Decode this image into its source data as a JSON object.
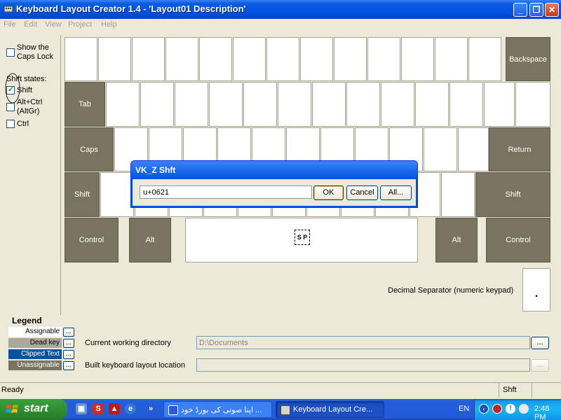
{
  "window": {
    "title": "Keyboard Layout Creator 1.4 - 'Layout01 Description'",
    "controls": {
      "minimize": "_",
      "restore": "❐",
      "close": "✕"
    }
  },
  "menu": [
    "File",
    "Edit",
    "View",
    "Project",
    "Help"
  ],
  "left_panel": {
    "show_caps_lock_line1": "Show the",
    "show_caps_lock_line2": "Caps Lock",
    "show_caps_lock_checked": false,
    "shift_states_label": "Shift states:",
    "shift_label": "Shift",
    "shift_checked": true,
    "altctrl_line1": "Alt+Ctrl",
    "altctrl_line2": "(AltGr)",
    "altctrl_checked": false,
    "ctrl_label": "Ctrl",
    "ctrl_checked": false
  },
  "keyboard": {
    "backspace": "Backspace",
    "tab": "Tab",
    "caps": "Caps",
    "return": "Return",
    "shift_left": "Shift",
    "shift_right": "Shift",
    "control_left": "Control",
    "alt_left": "Alt",
    "space_label": "S P",
    "alt_right": "Alt",
    "control_right": "Control"
  },
  "dialog": {
    "title": "VK_Z   Shft",
    "value": "u+0621",
    "ok": "OK",
    "cancel": "Cancel",
    "all": "All..."
  },
  "decimal": {
    "label": "Decimal Separator (numeric keypad)",
    "key": "."
  },
  "legend": {
    "title": "Legend",
    "items": [
      {
        "label": "Assignable",
        "color": "#ffffff",
        "text_color": "#000000"
      },
      {
        "label": "Dead key",
        "color": "#aca899",
        "text_color": "#000000"
      },
      {
        "label": "Clipped Text",
        "color": "#0a50a0",
        "text_color": "#ffffff"
      },
      {
        "label": "Unassignable",
        "color": "#787460",
        "text_color": "#ffffff"
      }
    ],
    "button": "..."
  },
  "directories": {
    "working_label": "Current working directory",
    "working_value": "D:\\Documents",
    "built_label": "Built keyboard layout location",
    "built_value": "",
    "browse": "..."
  },
  "status": {
    "ready": "Ready",
    "state": "Shft"
  },
  "taskbar": {
    "start": "start",
    "items": [
      {
        "label": "اپنا صوتی کی بورڈ خود ...",
        "active": false
      },
      {
        "label": "Keyboard Layout Cre...",
        "active": true
      }
    ],
    "lang": "EN",
    "clock": "2:48 PM"
  }
}
